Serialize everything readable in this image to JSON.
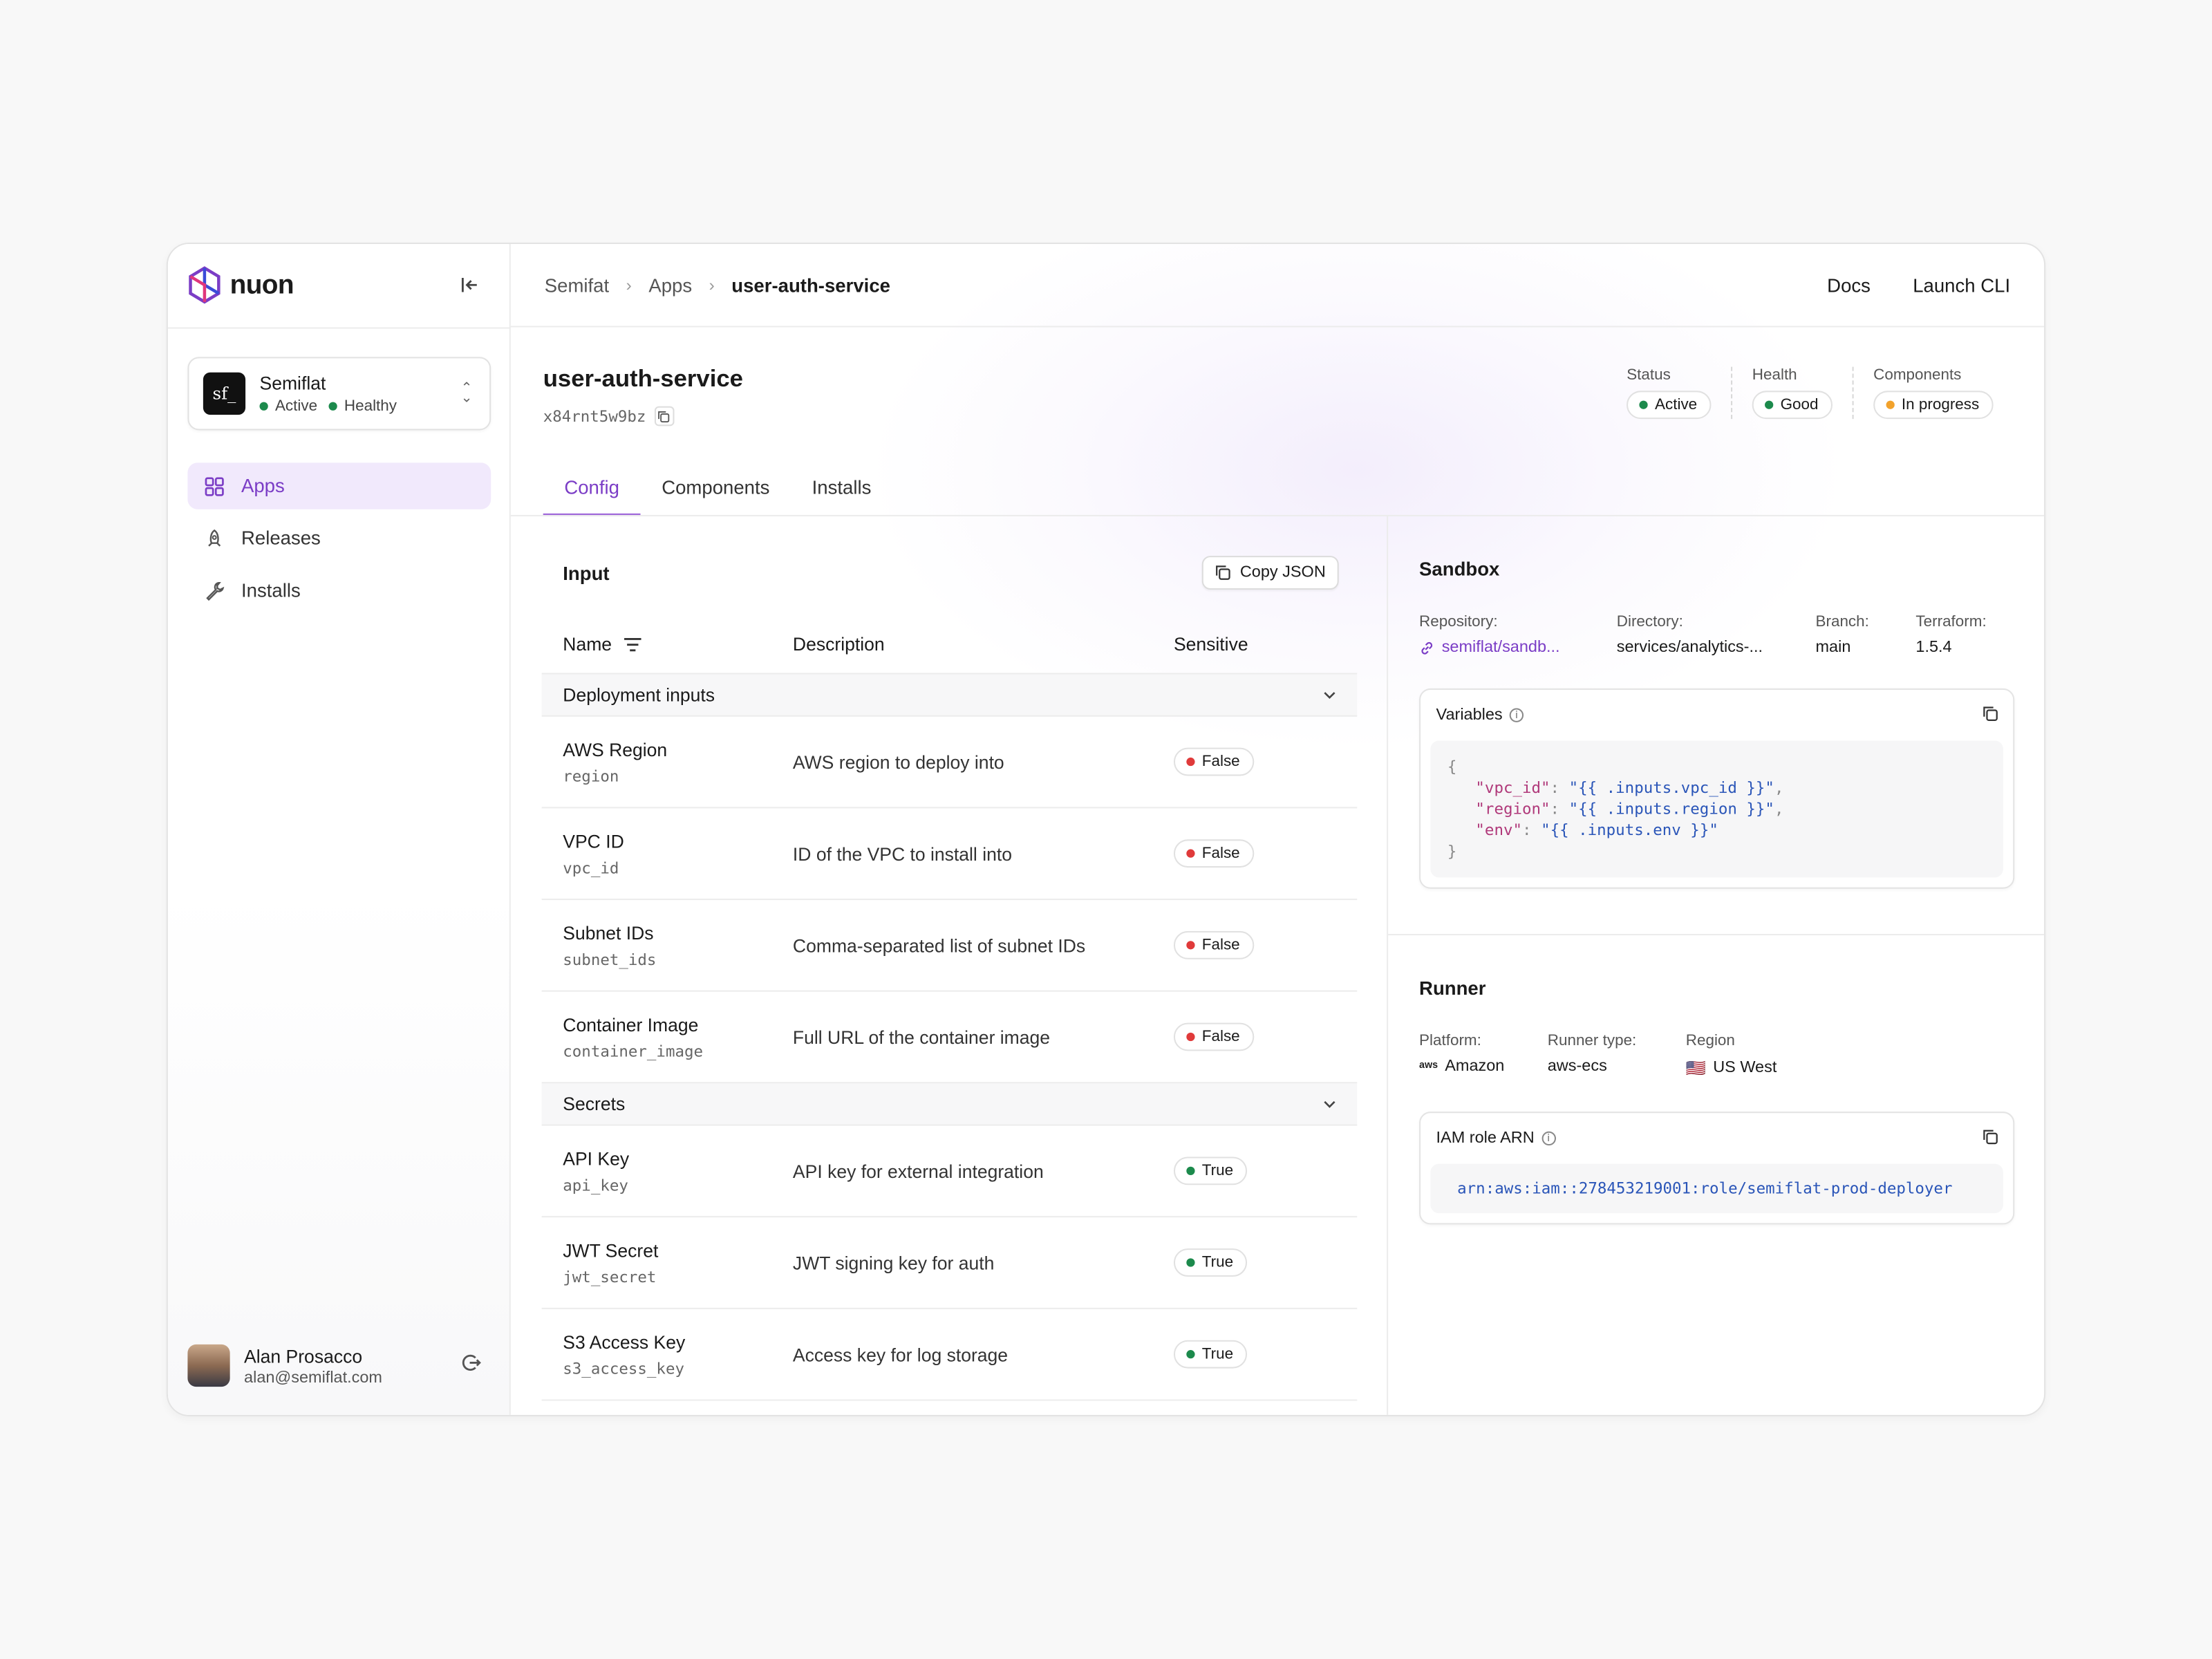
{
  "brand": {
    "name": "nuon"
  },
  "org": {
    "name": "Semiflat",
    "logo_text": "sf_",
    "status": "Active",
    "health": "Healthy"
  },
  "nav": [
    {
      "label": "Apps",
      "icon": "grid-icon",
      "active": true
    },
    {
      "label": "Releases",
      "icon": "rocket-icon",
      "active": false
    },
    {
      "label": "Installs",
      "icon": "wrench-icon",
      "active": false
    }
  ],
  "user": {
    "name": "Alan Prosacco",
    "email": "alan@semiflat.com"
  },
  "breadcrumbs": {
    "org": "Semifat",
    "section": "Apps",
    "current": "user-auth-service"
  },
  "header_actions": {
    "docs": "Docs",
    "launch_cli": "Launch CLI"
  },
  "app": {
    "title": "user-auth-service",
    "id": "x84rnt5w9bz"
  },
  "stats": {
    "status": {
      "label": "Status",
      "value": "Active",
      "color": "#1c8a4c"
    },
    "health": {
      "label": "Health",
      "value": "Good",
      "color": "#1c8a4c"
    },
    "components": {
      "label": "Components",
      "value": "In progress",
      "color": "#f2a22c"
    }
  },
  "tabs": [
    "Config",
    "Components",
    "Installs"
  ],
  "input": {
    "title": "Input",
    "copy_json": "Copy JSON",
    "columns": {
      "name": "Name",
      "description": "Description",
      "sensitive": "Sensitive"
    },
    "groups": [
      {
        "title": "Deployment inputs",
        "rows": [
          {
            "label": "AWS Region",
            "key": "region",
            "description": "AWS region to deploy into",
            "sensitive": "False"
          },
          {
            "label": "VPC ID",
            "key": "vpc_id",
            "description": "ID of the VPC to install into",
            "sensitive": "False"
          },
          {
            "label": "Subnet IDs",
            "key": "subnet_ids",
            "description": "Comma-separated list of subnet IDs",
            "sensitive": "False"
          },
          {
            "label": "Container Image",
            "key": "container_image",
            "description": "Full URL of the container image",
            "sensitive": "False"
          }
        ]
      },
      {
        "title": "Secrets",
        "rows": [
          {
            "label": "API Key",
            "key": "api_key",
            "description": "API key for external integration",
            "sensitive": "True"
          },
          {
            "label": "JWT Secret",
            "key": "jwt_secret",
            "description": "JWT signing key for auth",
            "sensitive": "True"
          },
          {
            "label": "S3 Access Key",
            "key": "s3_access_key",
            "description": "Access key for log storage",
            "sensitive": "True"
          }
        ]
      }
    ]
  },
  "sandbox": {
    "title": "Sandbox",
    "repository": {
      "label": "Repository:",
      "value": "semiflat/sandb..."
    },
    "directory": {
      "label": "Directory:",
      "value": "services/analytics-..."
    },
    "branch": {
      "label": "Branch:",
      "value": "main"
    },
    "terraform": {
      "label": "Terraform:",
      "value": "1.5.4"
    },
    "variables_label": "Variables",
    "variables": [
      {
        "key": "\"vpc_id\"",
        "value": "\"{{ .inputs.vpc_id }}\""
      },
      {
        "key": "\"region\"",
        "value": "\"{{ .inputs.region }}\""
      },
      {
        "key": "\"env\"",
        "value": "\"{{ .inputs.env }}\""
      }
    ]
  },
  "runner": {
    "title": "Runner",
    "platform": {
      "label": "Platform:",
      "value": "Amazon",
      "badge": "aws"
    },
    "runner_type": {
      "label": "Runner type:",
      "value": "aws-ecs"
    },
    "region": {
      "label": "Region",
      "value": "US West",
      "flag": "🇺🇸"
    },
    "iam_label": "IAM role ARN",
    "iam_arn": "arn:aws:iam::278453219001:role/semiflat-prod-deployer"
  },
  "colors": {
    "accent": "#7b3dc6",
    "true": "#1c8a4c",
    "false": "#e03a3a",
    "in_progress": "#f2a22c"
  }
}
